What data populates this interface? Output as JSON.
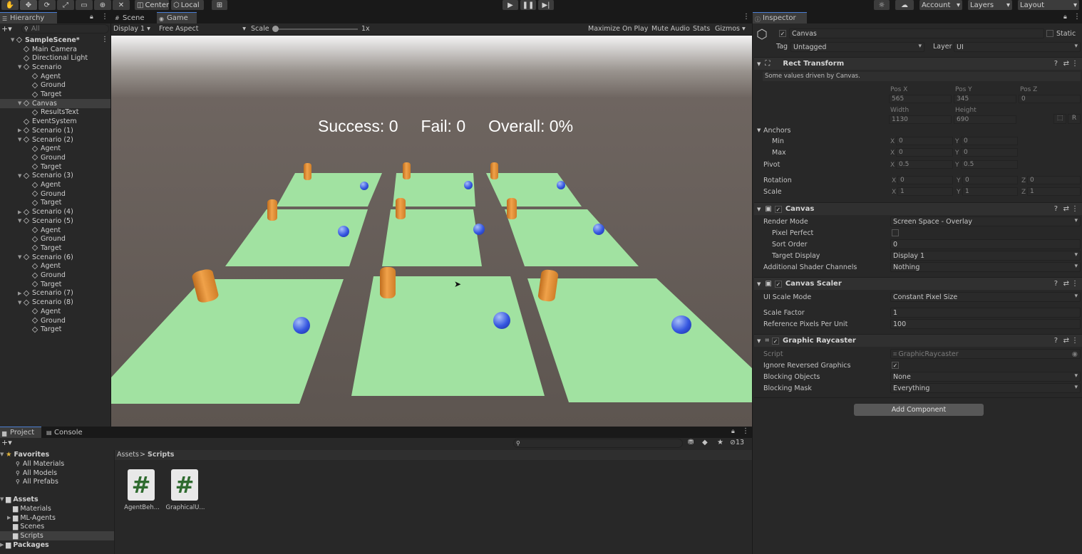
{
  "toolbar": {
    "center_label": "Center",
    "local_label": "Local",
    "account_label": "Account",
    "layers_label": "Layers",
    "layout_label": "Layout"
  },
  "hierarchy": {
    "tab_label": "Hierarchy",
    "search_placeholder": "All",
    "items": [
      {
        "label": "SampleScene*",
        "depth": 0,
        "arrow": "▼",
        "selected": false
      },
      {
        "label": "Main Camera",
        "depth": 1,
        "arrow": "",
        "selected": false
      },
      {
        "label": "Directional Light",
        "depth": 1,
        "arrow": "",
        "selected": false
      },
      {
        "label": "Scenario",
        "depth": 1,
        "arrow": "▼",
        "selected": false
      },
      {
        "label": "Agent",
        "depth": 2,
        "arrow": "",
        "selected": false
      },
      {
        "label": "Ground",
        "depth": 2,
        "arrow": "",
        "selected": false
      },
      {
        "label": "Target",
        "depth": 2,
        "arrow": "",
        "selected": false
      },
      {
        "label": "Canvas",
        "depth": 1,
        "arrow": "▼",
        "selected": true
      },
      {
        "label": "ResultsText",
        "depth": 2,
        "arrow": "",
        "selected": false
      },
      {
        "label": "EventSystem",
        "depth": 1,
        "arrow": "",
        "selected": false
      },
      {
        "label": "Scenario (1)",
        "depth": 1,
        "arrow": "▶",
        "selected": false
      },
      {
        "label": "Scenario (2)",
        "depth": 1,
        "arrow": "▼",
        "selected": false
      },
      {
        "label": "Agent",
        "depth": 2,
        "arrow": "",
        "selected": false
      },
      {
        "label": "Ground",
        "depth": 2,
        "arrow": "",
        "selected": false
      },
      {
        "label": "Target",
        "depth": 2,
        "arrow": "",
        "selected": false
      },
      {
        "label": "Scenario (3)",
        "depth": 1,
        "arrow": "▼",
        "selected": false
      },
      {
        "label": "Agent",
        "depth": 2,
        "arrow": "",
        "selected": false
      },
      {
        "label": "Ground",
        "depth": 2,
        "arrow": "",
        "selected": false
      },
      {
        "label": "Target",
        "depth": 2,
        "arrow": "",
        "selected": false
      },
      {
        "label": "Scenario (4)",
        "depth": 1,
        "arrow": "▶",
        "selected": false
      },
      {
        "label": "Scenario (5)",
        "depth": 1,
        "arrow": "▼",
        "selected": false
      },
      {
        "label": "Agent",
        "depth": 2,
        "arrow": "",
        "selected": false
      },
      {
        "label": "Ground",
        "depth": 2,
        "arrow": "",
        "selected": false
      },
      {
        "label": "Target",
        "depth": 2,
        "arrow": "",
        "selected": false
      },
      {
        "label": "Scenario (6)",
        "depth": 1,
        "arrow": "▼",
        "selected": false
      },
      {
        "label": "Agent",
        "depth": 2,
        "arrow": "",
        "selected": false
      },
      {
        "label": "Ground",
        "depth": 2,
        "arrow": "",
        "selected": false
      },
      {
        "label": "Target",
        "depth": 2,
        "arrow": "",
        "selected": false
      },
      {
        "label": "Scenario (7)",
        "depth": 1,
        "arrow": "▶",
        "selected": false
      },
      {
        "label": "Scenario (8)",
        "depth": 1,
        "arrow": "▼",
        "selected": false
      },
      {
        "label": "Agent",
        "depth": 2,
        "arrow": "",
        "selected": false
      },
      {
        "label": "Ground",
        "depth": 2,
        "arrow": "",
        "selected": false
      },
      {
        "label": "Target",
        "depth": 2,
        "arrow": "",
        "selected": false
      }
    ]
  },
  "game": {
    "scene_tab": "Scene",
    "game_tab": "Game",
    "display_label": "Display 1",
    "aspect_label": "Free Aspect",
    "scale_label": "Scale",
    "scale_value": "1x",
    "maximize_label": "Maximize On Play",
    "mute_label": "Mute Audio",
    "stats_label": "Stats",
    "gizmos_label": "Gizmos",
    "hud_success": "Success: 0",
    "hud_fail": "Fail: 0",
    "hud_overall": "Overall: 0%"
  },
  "inspector": {
    "tab_label": "Inspector",
    "object_name": "Canvas",
    "static_label": "Static",
    "tag_label": "Tag",
    "tag_value": "Untagged",
    "layer_label": "Layer",
    "layer_value": "UI",
    "rect_transform": {
      "title": "Rect Transform",
      "note": "Some values driven by Canvas.",
      "pos_x_label": "Pos X",
      "pos_y_label": "Pos Y",
      "pos_z_label": "Pos Z",
      "pos_x": "565",
      "pos_y": "345",
      "pos_z": "0",
      "width_label": "Width",
      "height_label": "Height",
      "width": "1130",
      "height": "690",
      "r_label": "R",
      "anchors_label": "Anchors",
      "min_label": "Min",
      "max_label": "Max",
      "min_x": "0",
      "min_y": "0",
      "max_x": "0",
      "max_y": "0",
      "pivot_label": "Pivot",
      "pivot_x": "0.5",
      "pivot_y": "0.5",
      "rotation_label": "Rotation",
      "rot_x": "0",
      "rot_y": "0",
      "rot_z": "0",
      "scale_label": "Scale",
      "scale_x": "1",
      "scale_y": "1",
      "scale_z": "1",
      "axis_x": "X",
      "axis_y": "Y",
      "axis_z": "Z"
    },
    "canvas": {
      "title": "Canvas",
      "render_mode_label": "Render Mode",
      "render_mode": "Screen Space - Overlay",
      "pixel_perfect_label": "Pixel Perfect",
      "sort_order_label": "Sort Order",
      "sort_order": "0",
      "target_display_label": "Target Display",
      "target_display": "Display 1",
      "shader_channels_label": "Additional Shader Channels",
      "shader_channels": "Nothing"
    },
    "canvas_scaler": {
      "title": "Canvas Scaler",
      "ui_scale_mode_label": "UI Scale Mode",
      "ui_scale_mode": "Constant Pixel Size",
      "scale_factor_label": "Scale Factor",
      "scale_factor": "1",
      "ref_pixels_label": "Reference Pixels Per Unit",
      "ref_pixels": "100"
    },
    "graphic_raycaster": {
      "title": "Graphic Raycaster",
      "script_label": "Script",
      "script_value": "GraphicRaycaster",
      "ignore_reversed_label": "Ignore Reversed Graphics",
      "blocking_objects_label": "Blocking Objects",
      "blocking_objects": "None",
      "blocking_mask_label": "Blocking Mask",
      "blocking_mask": "Everything"
    },
    "add_component_label": "Add Component"
  },
  "project": {
    "project_tab": "Project",
    "console_tab": "Console",
    "favorites_label": "Favorites",
    "favorites": [
      "All Materials",
      "All Models",
      "All Prefabs"
    ],
    "assets_label": "Assets",
    "asset_folders": [
      "Materials",
      "ML-Agents",
      "Scenes",
      "Scripts"
    ],
    "packages_label": "Packages",
    "breadcrumb_root": "Assets",
    "breadcrumb_sep": ">",
    "breadcrumb_current": "Scripts",
    "hidden_count": "13",
    "files": [
      {
        "name": "AgentBeh...",
        "glyph": "#"
      },
      {
        "name": "GraphicalU...",
        "glyph": "#"
      }
    ]
  }
}
